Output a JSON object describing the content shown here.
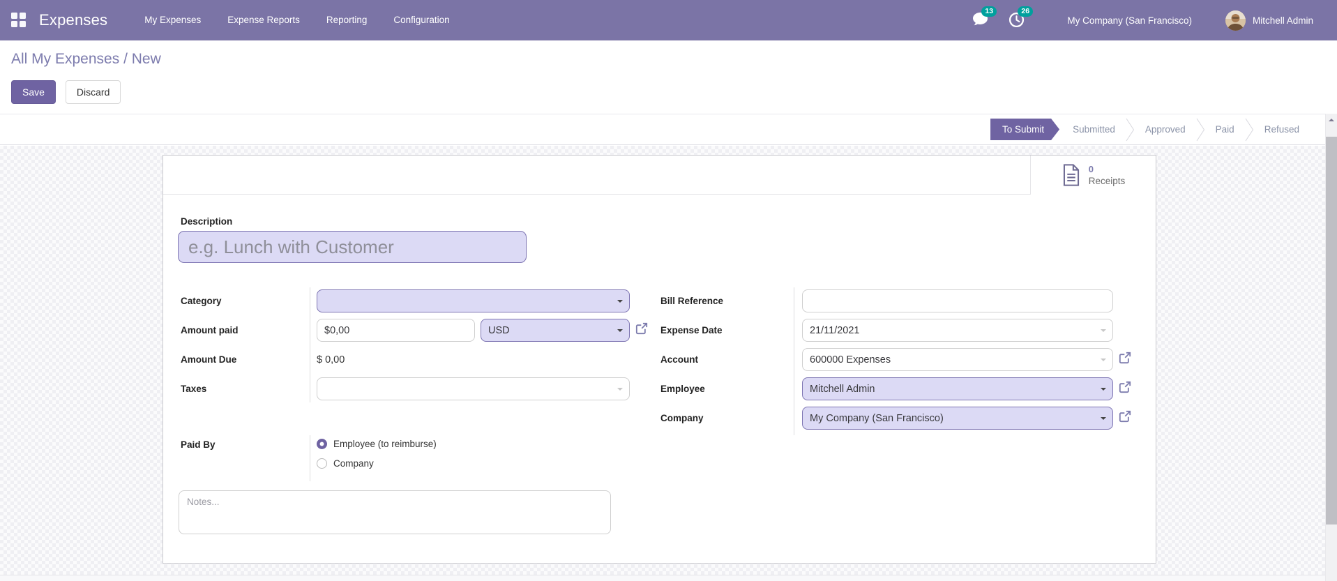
{
  "navbar": {
    "app_name": "Expenses",
    "menu_items": [
      {
        "label": "My Expenses"
      },
      {
        "label": "Expense Reports"
      },
      {
        "label": "Reporting"
      },
      {
        "label": "Configuration"
      }
    ],
    "messages_badge": "13",
    "activities_badge": "26",
    "company": "My Company (San Francisco)",
    "user": "Mitchell Admin"
  },
  "breadcrumb": {
    "parent": "All My Expenses",
    "separator": " / ",
    "current": "New"
  },
  "actions": {
    "save_label": "Save",
    "discard_label": "Discard"
  },
  "statusbar": {
    "steps": [
      {
        "label": "To Submit",
        "active": true
      },
      {
        "label": "Submitted",
        "active": false
      },
      {
        "label": "Approved",
        "active": false
      },
      {
        "label": "Paid",
        "active": false
      },
      {
        "label": "Refused",
        "active": false
      }
    ]
  },
  "button_box": {
    "receipts_count": "0",
    "receipts_label": "Receipts"
  },
  "form": {
    "description": {
      "label": "Description",
      "placeholder": "e.g. Lunch with Customer"
    },
    "left": {
      "category_label": "Category",
      "category_value": "",
      "amount_paid_label": "Amount paid",
      "amount_paid_value": "$0,00",
      "currency_value": "USD",
      "amount_due_label": "Amount Due",
      "amount_due_value": "$ 0,00",
      "taxes_label": "Taxes",
      "taxes_value": "",
      "paid_by_label": "Paid By",
      "paid_by_options": [
        "Employee (to reimburse)",
        "Company"
      ],
      "paid_by_selected": "Employee (to reimburse)",
      "notes_placeholder": "Notes..."
    },
    "right": {
      "bill_reference_label": "Bill Reference",
      "bill_reference_value": "",
      "expense_date_label": "Expense Date",
      "expense_date_value": "21/11/2021",
      "account_label": "Account",
      "account_value": "600000 Expenses",
      "employee_label": "Employee",
      "employee_value": "Mitchell Admin",
      "company_label": "Company",
      "company_value": "My Company (San Francisco)"
    }
  },
  "colors": {
    "navbar_bg": "#7b74a6",
    "primary": "#6f63a2",
    "breadcrumb_link": "#7c7bad",
    "badge_bg": "#00a09d",
    "required_field_bg": "#dcdaf5",
    "required_field_border": "#7d74b2"
  }
}
